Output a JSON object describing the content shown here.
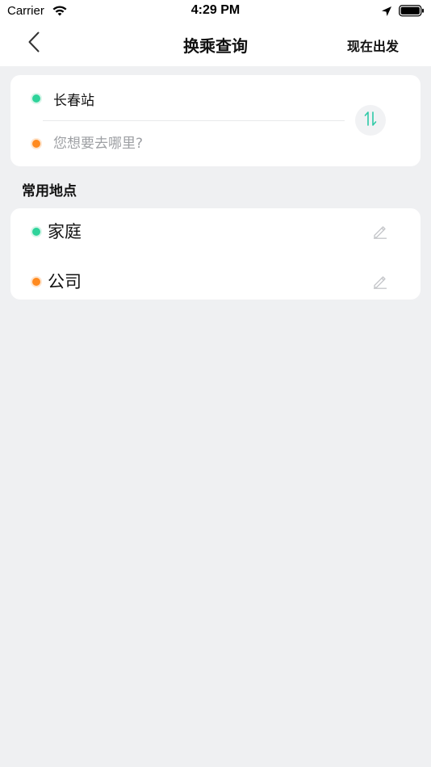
{
  "status_bar": {
    "carrier": "Carrier",
    "time": "4:29 PM",
    "icons": [
      "wifi-icon",
      "location-arrow-icon",
      "battery-icon"
    ]
  },
  "nav": {
    "back_icon": "chevron-left-icon",
    "title": "换乘查询",
    "right_action": "现在出发"
  },
  "route": {
    "origin": "长春站",
    "destination_placeholder": "您想要去哪里?",
    "destination_value": "",
    "swap_icon": "swap-vertical-icon",
    "origin_color": "#2ed39a",
    "destination_color": "#ff8a1f",
    "swap_color": "#2ec9a6"
  },
  "frequent_places": {
    "title": "常用地点",
    "items": [
      {
        "label": "家庭",
        "dot_color": "#2ed39a",
        "icon": "pencil-edit-icon"
      },
      {
        "label": "公司",
        "dot_color": "#ff8a1f",
        "icon": "pencil-edit-icon"
      }
    ]
  },
  "colors": {
    "background": "#eff0f2",
    "card": "#ffffff",
    "text": "#111111",
    "placeholder": "#9ea0a4"
  }
}
